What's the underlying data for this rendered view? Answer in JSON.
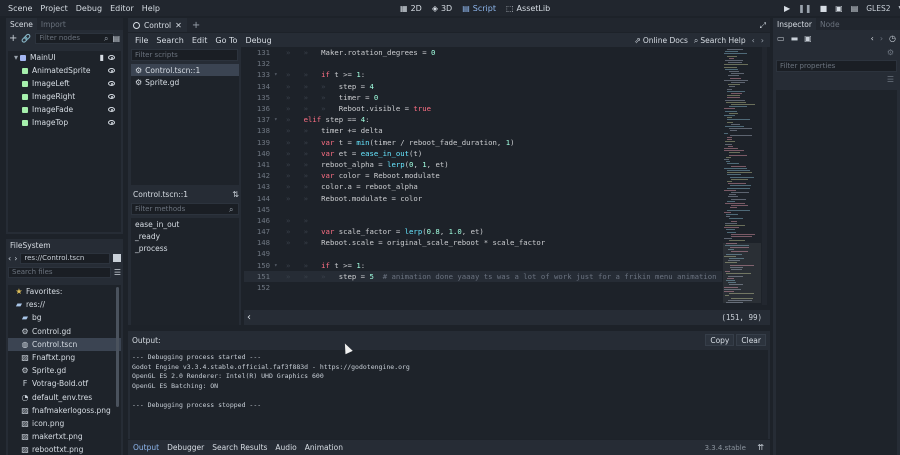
{
  "topbar": {
    "menus": [
      "Scene",
      "Project",
      "Debug",
      "Editor",
      "Help"
    ],
    "workspaces": [
      {
        "label": "2D",
        "icon": "2d-icon",
        "active": false
      },
      {
        "label": "3D",
        "icon": "3d-icon",
        "active": false
      },
      {
        "label": "Script",
        "icon": "script-icon",
        "active": true
      },
      {
        "label": "AssetLib",
        "icon": "assetlib-icon",
        "active": false
      }
    ],
    "renderer": "GLES2"
  },
  "scene_dock": {
    "tabs": [
      "Scene",
      "Import"
    ],
    "filter_placeholder": "Filter nodes",
    "nodes": [
      {
        "label": "MainUI",
        "color": "#a5b7f3",
        "root": true
      },
      {
        "label": "AnimatedSprite",
        "color": "#a5efac",
        "root": false
      },
      {
        "label": "ImageLeft",
        "color": "#a5efac",
        "root": false
      },
      {
        "label": "ImageRight",
        "color": "#a5efac",
        "root": false
      },
      {
        "label": "ImageFade",
        "color": "#a5efac",
        "root": false
      },
      {
        "label": "ImageTop",
        "color": "#a5efac",
        "root": false
      }
    ]
  },
  "filesystem": {
    "title": "FileSystem",
    "path": "res://Control.tscn",
    "search_placeholder": "Search files",
    "items": [
      {
        "label": "Favorites:",
        "indent": 1,
        "icon": "star-icon",
        "selected": false
      },
      {
        "label": "res://",
        "indent": 1,
        "icon": "folder-icon",
        "selected": false
      },
      {
        "label": "bg",
        "indent": 2,
        "icon": "folder-icon",
        "selected": false
      },
      {
        "label": "Control.gd",
        "indent": 2,
        "icon": "gear-icon",
        "selected": false
      },
      {
        "label": "Control.tscn",
        "indent": 2,
        "icon": "scene-icon",
        "selected": true
      },
      {
        "label": "Fnaftxt.png",
        "indent": 2,
        "icon": "image-icon",
        "selected": false
      },
      {
        "label": "Sprite.gd",
        "indent": 2,
        "icon": "gear-icon",
        "selected": false
      },
      {
        "label": "Votrag-Bold.otf",
        "indent": 2,
        "icon": "font-icon",
        "selected": false
      },
      {
        "label": "default_env.tres",
        "indent": 2,
        "icon": "resource-icon",
        "selected": false
      },
      {
        "label": "fnafmakerlogoss.png",
        "indent": 2,
        "icon": "image-icon",
        "selected": false
      },
      {
        "label": "icon.png",
        "indent": 2,
        "icon": "image-icon",
        "selected": false
      },
      {
        "label": "makertxt.png",
        "indent": 2,
        "icon": "image-icon",
        "selected": false
      },
      {
        "label": "reboottxt.png",
        "indent": 2,
        "icon": "image-icon",
        "selected": false
      }
    ]
  },
  "editor_tabs": {
    "active_tab": "Control"
  },
  "script_menu": {
    "items": [
      "File",
      "Search",
      "Edit",
      "Go To",
      "Debug"
    ],
    "online_docs": "Online Docs",
    "search_help": "Search Help"
  },
  "scripts_panel": {
    "filter_placeholder": "Filter scripts",
    "scripts": [
      {
        "label": "Control.tscn::1",
        "selected": true
      },
      {
        "label": "Sprite.gd",
        "selected": false
      }
    ],
    "methods_title": "Control.tscn::1",
    "methods_filter_placeholder": "Filter methods",
    "methods": [
      "ease_in_out",
      "_ready",
      "_process"
    ]
  },
  "code": {
    "lines": [
      {
        "n": "131",
        "indent": 2,
        "fold": false,
        "tokens": [
          [
            "tx",
            "Maker.rotation_degrees = "
          ],
          [
            "num",
            "0"
          ]
        ]
      },
      {
        "n": "132",
        "indent": 0,
        "fold": false,
        "tokens": []
      },
      {
        "n": "133",
        "indent": 2,
        "fold": true,
        "tokens": [
          [
            "kw",
            "if"
          ],
          [
            "tx",
            " t >= "
          ],
          [
            "num",
            "1"
          ],
          [
            "tx",
            ":"
          ]
        ]
      },
      {
        "n": "134",
        "indent": 3,
        "fold": false,
        "tokens": [
          [
            "tx",
            "step = "
          ],
          [
            "num",
            "4"
          ]
        ]
      },
      {
        "n": "135",
        "indent": 3,
        "fold": false,
        "tokens": [
          [
            "tx",
            "timer = "
          ],
          [
            "num",
            "0"
          ]
        ]
      },
      {
        "n": "136",
        "indent": 3,
        "fold": false,
        "tokens": [
          [
            "tx",
            "Reboot.visible = "
          ],
          [
            "kw",
            "true"
          ]
        ]
      },
      {
        "n": "137",
        "indent": 1,
        "fold": true,
        "tokens": [
          [
            "kw",
            "elif"
          ],
          [
            "tx",
            " step == "
          ],
          [
            "num",
            "4"
          ],
          [
            "tx",
            ":"
          ]
        ]
      },
      {
        "n": "138",
        "indent": 2,
        "fold": false,
        "tokens": [
          [
            "tx",
            "timer += delta"
          ]
        ]
      },
      {
        "n": "139",
        "indent": 2,
        "fold": false,
        "tokens": [
          [
            "kw",
            "var"
          ],
          [
            "tx",
            " t = "
          ],
          [
            "fn",
            "min"
          ],
          [
            "tx",
            "(timer / reboot_fade_duration, "
          ],
          [
            "num",
            "1"
          ],
          [
            "tx",
            ")"
          ]
        ]
      },
      {
        "n": "140",
        "indent": 2,
        "fold": false,
        "tokens": [
          [
            "kw",
            "var"
          ],
          [
            "tx",
            " et = "
          ],
          [
            "fn",
            "ease_in_out"
          ],
          [
            "tx",
            "(t)"
          ]
        ]
      },
      {
        "n": "141",
        "indent": 2,
        "fold": false,
        "tokens": [
          [
            "tx",
            "reboot_alpha = "
          ],
          [
            "fn",
            "lerp"
          ],
          [
            "tx",
            "("
          ],
          [
            "num",
            "0"
          ],
          [
            "tx",
            ", "
          ],
          [
            "num",
            "1"
          ],
          [
            "tx",
            ", et)"
          ]
        ]
      },
      {
        "n": "142",
        "indent": 2,
        "fold": false,
        "tokens": [
          [
            "kw",
            "var"
          ],
          [
            "tx",
            " color = Reboot.modulate"
          ]
        ]
      },
      {
        "n": "143",
        "indent": 2,
        "fold": false,
        "tokens": [
          [
            "tx",
            "color.a = reboot_alpha"
          ]
        ]
      },
      {
        "n": "144",
        "indent": 2,
        "fold": false,
        "tokens": [
          [
            "tx",
            "Reboot.modulate = color"
          ]
        ]
      },
      {
        "n": "145",
        "indent": 0,
        "fold": false,
        "tokens": []
      },
      {
        "n": "146",
        "indent": 2,
        "fold": false,
        "tokens": []
      },
      {
        "n": "147",
        "indent": 2,
        "fold": false,
        "tokens": [
          [
            "kw",
            "var"
          ],
          [
            "tx",
            " scale_factor = "
          ],
          [
            "fn",
            "lerp"
          ],
          [
            "tx",
            "("
          ],
          [
            "num",
            "0.8"
          ],
          [
            "tx",
            ", "
          ],
          [
            "num",
            "1.0"
          ],
          [
            "tx",
            ", et)"
          ]
        ]
      },
      {
        "n": "148",
        "indent": 2,
        "fold": false,
        "tokens": [
          [
            "tx",
            "Reboot.scale = original_scale_reboot * scale_factor"
          ]
        ]
      },
      {
        "n": "149",
        "indent": 0,
        "fold": false,
        "tokens": []
      },
      {
        "n": "150",
        "indent": 2,
        "fold": true,
        "tokens": [
          [
            "kw",
            "if"
          ],
          [
            "tx",
            " t >= "
          ],
          [
            "num",
            "1"
          ],
          [
            "tx",
            ":"
          ]
        ]
      },
      {
        "n": "151",
        "indent": 3,
        "fold": false,
        "tokens": [
          [
            "tx",
            "step = "
          ],
          [
            "num",
            "5"
          ],
          [
            "tx",
            "  "
          ],
          [
            "cm",
            "# animation done yaaay ts was a lot of work just for a frikin menu animation"
          ]
        ],
        "current": true
      },
      {
        "n": "152",
        "indent": 0,
        "fold": false,
        "tokens": []
      }
    ],
    "cursor_position": "(151, 99)"
  },
  "output": {
    "title": "Output:",
    "copy_label": "Copy",
    "clear_label": "Clear",
    "lines": [
      "--- Debugging process started ---",
      "Godot Engine v3.3.4.stable.official.faf3f883d - https://godotengine.org",
      "OpenGL ES 2.0 Renderer: Intel(R) UHD Graphics 600",
      "OpenGL ES Batching: ON",
      "",
      "--- Debugging process stopped ---"
    ]
  },
  "bottom_panel": {
    "tabs": [
      "Output",
      "Debugger",
      "Search Results",
      "Audio",
      "Animation"
    ],
    "active_tab": "Output",
    "version": "3.3.4.stable"
  },
  "inspector": {
    "tabs": [
      "Inspector",
      "Node"
    ],
    "filter_placeholder": "Filter properties"
  }
}
